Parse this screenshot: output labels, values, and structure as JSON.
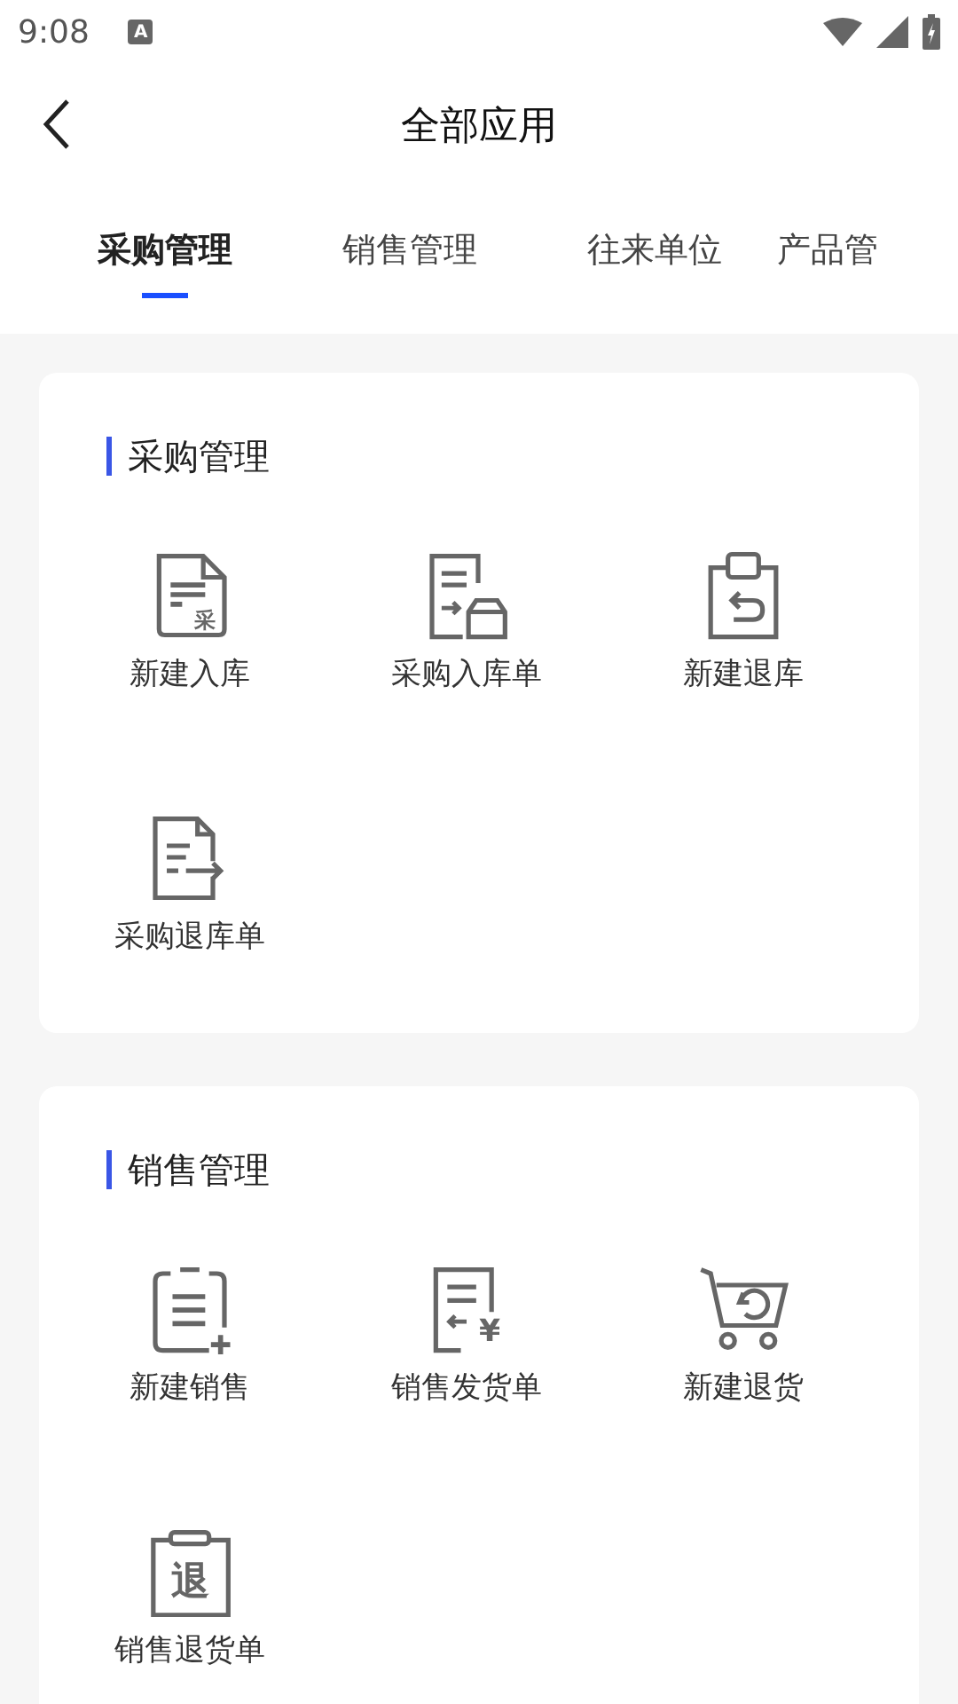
{
  "status_bar": {
    "time": "9:08",
    "notification_glyph": "A"
  },
  "header": {
    "title": "全部应用"
  },
  "tabs": [
    {
      "label": "采购管理",
      "selected": true
    },
    {
      "label": "销售管理",
      "selected": false
    },
    {
      "label": "往来单位",
      "selected": false
    },
    {
      "label": "产品管",
      "selected": false
    }
  ],
  "sections": [
    {
      "title": "采购管理",
      "items": [
        {
          "label": "新建入库",
          "kind": "doc-glyph",
          "glyph": "采"
        },
        {
          "label": "采购入库单",
          "kind": "doc-box"
        },
        {
          "label": "新建退库",
          "kind": "clipboard-return"
        },
        {
          "label": "采购退库单",
          "kind": "doc-arrow"
        }
      ]
    },
    {
      "title": "销售管理",
      "items": [
        {
          "label": "新建销售",
          "kind": "clipboard-plus"
        },
        {
          "label": "销售发货单",
          "kind": "doc-yen",
          "glyph": "¥"
        },
        {
          "label": "新建退货",
          "kind": "cart-return"
        },
        {
          "label": "销售退货单",
          "kind": "clipboard-glyph",
          "glyph": "退"
        }
      ]
    }
  ]
}
